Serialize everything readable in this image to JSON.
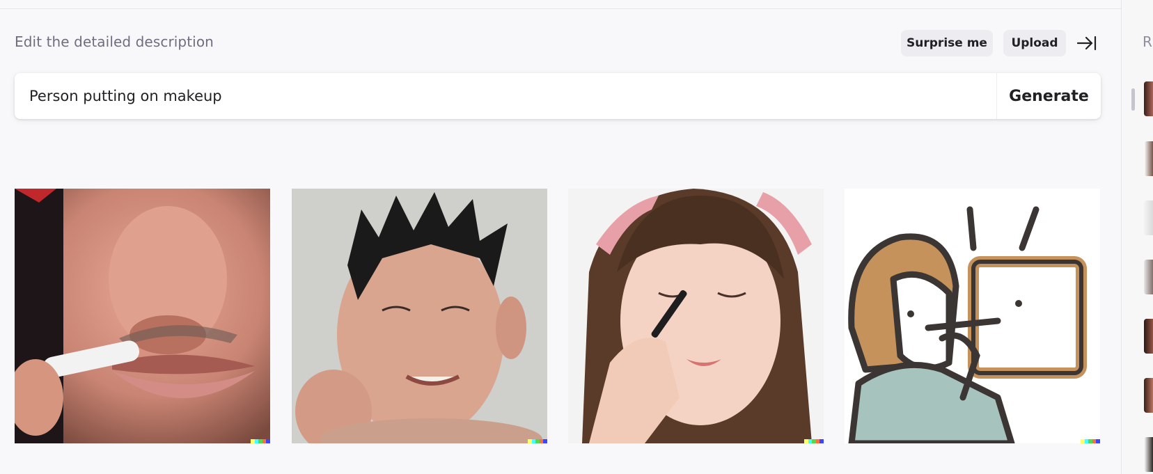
{
  "header": {
    "description_label": "Edit the detailed description",
    "surprise_label": "Surprise me",
    "upload_label": "Upload",
    "collapse_icon": "arrow-right-bar-icon"
  },
  "prompt": {
    "value": "Person putting on makeup",
    "generate_label": "Generate"
  },
  "results": [
    {
      "alt": "Close-up of a man's lips with a white crayon",
      "style": "photo"
    },
    {
      "alt": "Man with spiky hair smiling",
      "style": "photo"
    },
    {
      "alt": "Young woman applying eye makeup with a brush",
      "style": "photo"
    },
    {
      "alt": "Illustration of a woman applying makeup in a mirror",
      "style": "illustration"
    }
  ],
  "watermark_colors": [
    "#ffff66",
    "#42ffff",
    "#51da4c",
    "#ff6e3c",
    "#3c46ff"
  ],
  "history": {
    "title": "R",
    "thumbnail_count": 7
  },
  "colors": {
    "background": "#f8f8fa",
    "pill": "#ececf1",
    "text": "#202123",
    "muted": "#6e6e80"
  }
}
